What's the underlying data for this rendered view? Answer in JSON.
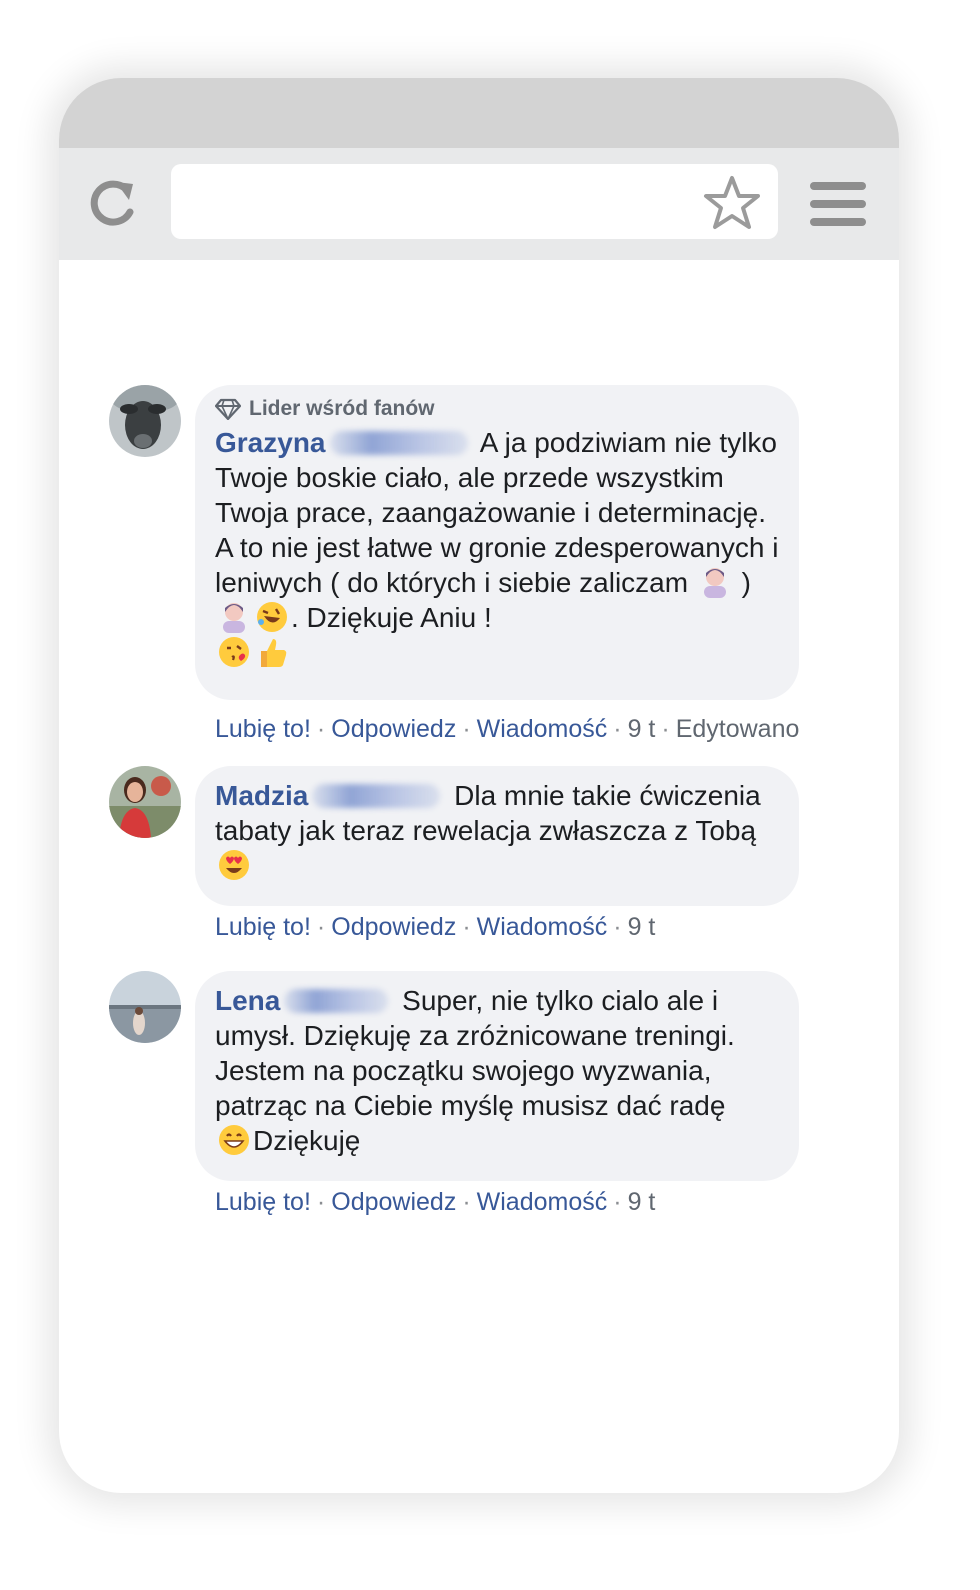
{
  "browser": {
    "reload_icon": "reload-icon",
    "star_icon": "star-icon",
    "menu_icon": "hamburger-menu-icon",
    "url_value": ""
  },
  "comments": [
    {
      "badge": "Lider wśród fanów",
      "badge_icon": "diamond-icon",
      "author_first": "Grazyna",
      "text_1": "A ja podziwiam nie tylko Twoje boskie ciało, ale przede wszystkim Twoja prace, zaangażowanie i determinację. A to nie jest łatwe w gronie zdesperowanych i leniwych ( do których i siebie zaliczam",
      "text_2": ")",
      "text_3": ". Dziękuje Aniu !",
      "emojis": [
        "woman-shrugging-emoji",
        "woman-shrugging-emoji",
        "rolling-laughing-emoji",
        "kissing-heart-emoji",
        "thumbs-up-emoji"
      ],
      "actions": {
        "like": "Lubię to!",
        "reply": "Odpowiedz",
        "message": "Wiadomość",
        "time": "9 t",
        "edited": "Edytowano"
      }
    },
    {
      "author_first": "Madzia",
      "text_1": "Dla mnie takie ćwiczenia tabaty jak teraz rewelacja zwłaszcza z Tobą",
      "emojis": [
        "heart-eyes-emoji"
      ],
      "actions": {
        "like": "Lubię to!",
        "reply": "Odpowiedz",
        "message": "Wiadomość",
        "time": "9 t"
      }
    },
    {
      "author_first": "Lena",
      "text_1": "Super, nie tylko cialo ale i umysł. Dziękuję za zróżnicowane treningi. Jestem na początku swojego wyzwania, patrząc na Ciebie myślę musisz dać radę",
      "text_2": "Dziękuję",
      "emojis": [
        "grinning-emoji"
      ],
      "actions": {
        "like": "Lubię to!",
        "reply": "Odpowiedz",
        "message": "Wiadomość",
        "time": "9 t"
      }
    }
  ],
  "colors": {
    "link": "#385898",
    "bubble": "#f1f2f5",
    "meta_text": "#606770",
    "body_text": "#1c1e21",
    "toolbar": "#e8e9ea",
    "phone_top": "#d3d3d3"
  }
}
